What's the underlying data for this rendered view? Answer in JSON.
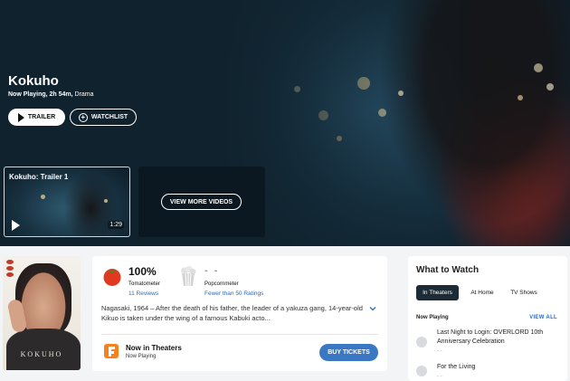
{
  "hero": {
    "title": "Kokuho",
    "meta_status": "Now Playing, 2h 54m,",
    "meta_genre": "Drama",
    "trailer_label": "TRAILER",
    "watchlist_label": "WATCHLIST"
  },
  "videos": {
    "card_title": "Kokuho: Trailer 1",
    "duration": "1:29",
    "view_more_label": "VIEW MORE VIDEOS"
  },
  "poster": {
    "title_text": "KOKUHO"
  },
  "scores": {
    "tomatometer_value": "100%",
    "tomatometer_label": "Tomatometer",
    "tomatometer_reviews": "11 Reviews",
    "popcornmeter_value": "- -",
    "popcornmeter_label": "Popcornmeter",
    "popcornmeter_reviews": "Fewer than 50 Ratings",
    "synopsis": "Nagasaki, 1964 – After the death of his father, the leader of a yakuza gang, 14-year-old Kikuo is taken under the wing of a famous Kabuki acto...",
    "now_in_theaters": "Now in Theaters",
    "now_playing": "Now Playing",
    "buy_tickets_label": "BUY TICKETS"
  },
  "what_to_watch": {
    "title": "What to Watch",
    "tabs": [
      "In Theaters",
      "At Home",
      "TV Shows"
    ],
    "section_label": "Now Playing",
    "view_all": "VIEW ALL",
    "items": [
      {
        "title": "Last Night to Login: OVERLORD 10th Anniversary Celebration",
        "score": "- -"
      },
      {
        "title": "For the Living",
        "score": "- -"
      }
    ]
  },
  "colors": {
    "hero_bg": "#10222e",
    "link_blue": "#2a6ac4",
    "ticket_button": "#3a78c4",
    "tab_active": "#1d2b36",
    "tomato_red": "#e0391f"
  }
}
